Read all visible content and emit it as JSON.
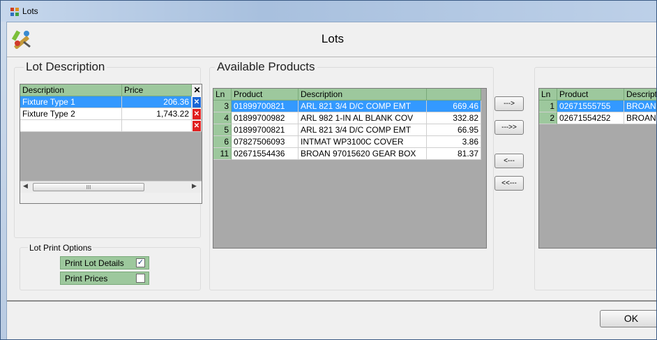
{
  "window": {
    "title": "Lots",
    "header_title": "Lots"
  },
  "lot_description": {
    "group_title": "Lot Description",
    "columns": [
      "Description",
      "Price"
    ],
    "rows": [
      {
        "description": "Fixture Type 1",
        "price": "206.36",
        "selected": true
      },
      {
        "description": "Fixture Type 2",
        "price": "1,743.22",
        "selected": false
      },
      {
        "description": "",
        "price": "",
        "selected": false
      }
    ],
    "hscroll_grip": "III"
  },
  "print_options": {
    "group_title": "Lot Print Options",
    "print_lot_details_label": "Print Lot Details",
    "print_lot_details_checked": true,
    "print_prices_label": "Print Prices",
    "print_prices_checked": false
  },
  "available_products": {
    "group_title": "Available Products",
    "columns": [
      "Ln",
      "Product",
      "Description",
      ""
    ],
    "rows": [
      {
        "ln": "3",
        "product": "01899700821",
        "description": "ARL 821 3/4 D/C COMP EMT",
        "value": "669.46",
        "selected": true
      },
      {
        "ln": "4",
        "product": "01899700982",
        "description": "ARL 982 1-IN AL BLANK COV",
        "value": "332.82",
        "selected": false
      },
      {
        "ln": "5",
        "product": "01899700821",
        "description": "ARL 821 3/4 D/C COMP EMT",
        "value": "66.95",
        "selected": false
      },
      {
        "ln": "6",
        "product": "07827506093",
        "description": "INTMAT WP3100C COVER",
        "value": "3.86",
        "selected": false
      },
      {
        "ln": "11",
        "product": "02671554436",
        "description": "BROAN 97015620 GEAR BOX",
        "value": "81.37",
        "selected": false
      }
    ]
  },
  "transfer_buttons": {
    "move_one_right": "--->",
    "move_all_right": "--->>",
    "move_one_left": "<---",
    "move_all_left": "<<---"
  },
  "lot_products": {
    "columns": [
      "Ln",
      "Product",
      "Description"
    ],
    "rows": [
      {
        "ln": "1",
        "product": "02671555755",
        "description": "BROAN",
        "selected": true
      },
      {
        "ln": "2",
        "product": "02671554252",
        "description": "BROAN",
        "selected": false
      }
    ]
  },
  "footer": {
    "ok_label": "OK"
  },
  "colors": {
    "grid_header": "#9dc89d",
    "selection": "#3399ff",
    "grid_background": "#a9a9a9",
    "delete_red": "#e02020",
    "delete_blue": "#1a66d6"
  }
}
